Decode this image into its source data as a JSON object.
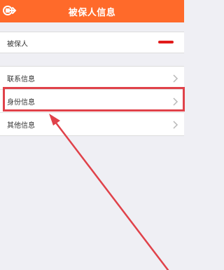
{
  "header": {
    "title": "被保人信息",
    "back_icon": "back-arrow-icon",
    "background": "#ff6a2a"
  },
  "insured": {
    "label": "被保人"
  },
  "info_items": [
    {
      "label": "联系信息",
      "icon": "chevron-right-icon"
    },
    {
      "label": "身份信息",
      "icon": "chevron-right-icon"
    },
    {
      "label": "其他信息",
      "icon": "chevron-right-icon"
    }
  ],
  "annotation": {
    "highlight_color": "#e0424a",
    "highlighted_item": "身份信息"
  },
  "colors": {
    "page_bg": "#efeff4",
    "row_bg": "#ffffff",
    "text": "#333333",
    "redaction": "#e11b1b"
  }
}
